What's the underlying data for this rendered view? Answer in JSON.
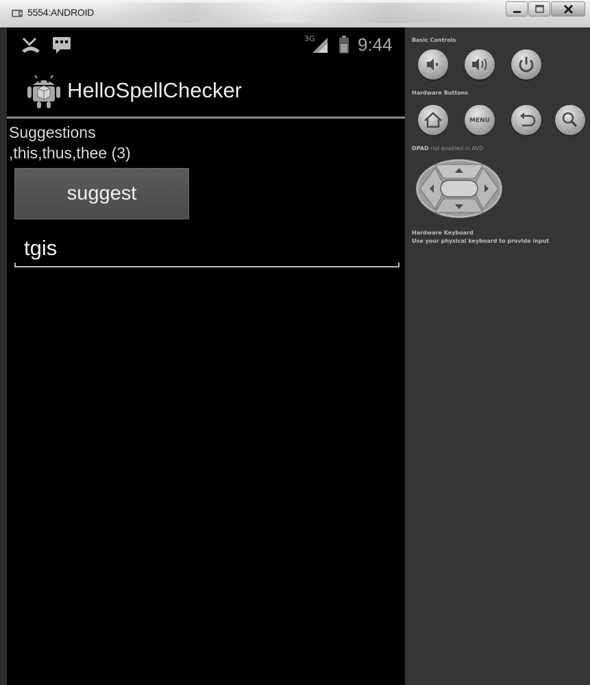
{
  "window": {
    "title": "5554:ANDROID"
  },
  "status_bar": {
    "network": "3G",
    "time": "9:44"
  },
  "app": {
    "title": "HelloSpellChecker",
    "suggestions_label": "Suggestions",
    "suggestions_text": ",this,thus,thee (3)",
    "suggest_button_label": "suggest",
    "input_value": "tgis"
  },
  "controls": {
    "basic_controls_label": "Basic Controls",
    "hardware_buttons_label": "Hardware Buttons",
    "dpad_label": "DPAD",
    "dpad_note": "not enabled in AVD",
    "keyboard_label": "Hardware Keyboard",
    "keyboard_note": "Use your physical keyboard to provide input",
    "menu_label": "MENU"
  }
}
